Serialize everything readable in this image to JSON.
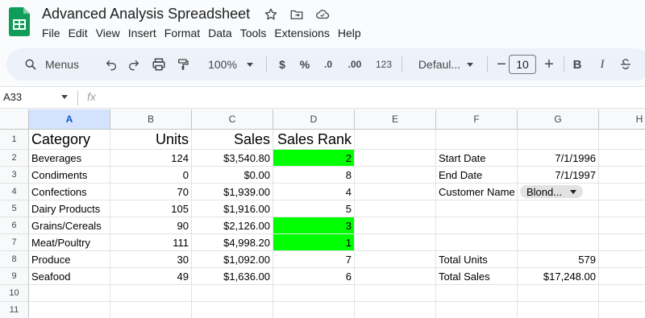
{
  "app": {
    "title": "Advanced Analysis Spreadsheet",
    "menu": [
      "File",
      "Edit",
      "View",
      "Insert",
      "Format",
      "Data",
      "Tools",
      "Extensions",
      "Help"
    ]
  },
  "toolbar": {
    "search_label": "Menus",
    "zoom": "100%",
    "currency": "$",
    "percent": "%",
    "dec_decrease": ".0",
    "dec_increase": ".00",
    "number_format": "123",
    "font": "Defaul...",
    "font_size": "10",
    "bold": "B",
    "italic": "I"
  },
  "formula_bar": {
    "name_box": "A33",
    "fx": "fx",
    "value": ""
  },
  "columns": [
    "A",
    "B",
    "C",
    "D",
    "E",
    "F",
    "G",
    "H"
  ],
  "selected_column": "A",
  "rows": [
    "1",
    "2",
    "3",
    "4",
    "5",
    "6",
    "7",
    "8",
    "9",
    "10",
    "11"
  ],
  "cells": {
    "A1": "Category",
    "B1": "Units",
    "C1": "Sales",
    "D1": "Sales Rank",
    "A2": "Beverages",
    "B2": "124",
    "C2": "$3,540.80",
    "D2": "2",
    "A3": "Condiments",
    "B3": "0",
    "C3": "$0.00",
    "D3": "8",
    "A4": "Confections",
    "B4": "70",
    "C4": "$1,939.00",
    "D4": "4",
    "A5": "Dairy Products",
    "B5": "105",
    "C5": "$1,916.00",
    "D5": "5",
    "A6": "Grains/Cereals",
    "B6": "90",
    "C6": "$2,126.00",
    "D6": "3",
    "A7": "Meat/Poultry",
    "B7": "111",
    "C7": "$4,998.20",
    "D7": "1",
    "A8": "Produce",
    "B8": "30",
    "C8": "$1,092.00",
    "D8": "7",
    "A9": "Seafood",
    "B9": "49",
    "C9": "$1,636.00",
    "D9": "6",
    "F2": "Start Date",
    "G2": "7/1/1996",
    "F3": "End Date",
    "G3": "7/1/1997",
    "F4": "Customer Name",
    "G4": "Blond...",
    "F8": "Total Units",
    "G8": "579",
    "F9": "Total Sales",
    "G9": "$17,248.00"
  },
  "highlight_color": "#00ff00",
  "highlighted_cells": [
    "D2",
    "D6",
    "D7"
  ]
}
